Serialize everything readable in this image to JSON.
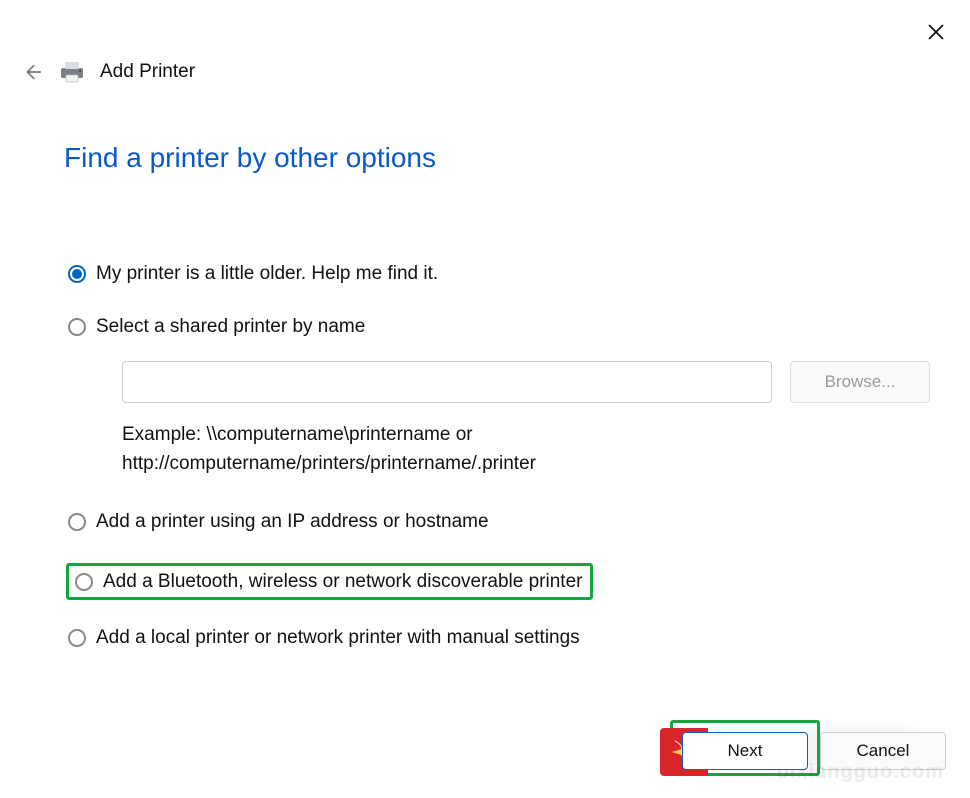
{
  "window": {
    "title": "Add Printer"
  },
  "page": {
    "heading": "Find a printer by other options"
  },
  "options": {
    "older": {
      "label": "My printer is a little older. Help me find it.",
      "selected": true
    },
    "shared": {
      "label": "Select a shared printer by name",
      "selected": false,
      "input_value": "",
      "browse_label": "Browse...",
      "example_line1": "Example: \\\\computername\\printername or",
      "example_line2": "http://computername/printers/printername/.printer"
    },
    "ip": {
      "label": "Add a printer using an IP address or hostname",
      "selected": false
    },
    "bluetooth": {
      "label": "Add a Bluetooth, wireless or network discoverable printer",
      "selected": false,
      "highlighted": true
    },
    "local": {
      "label": "Add a local printer or network printer with manual settings",
      "selected": false
    }
  },
  "footer": {
    "next_label": "Next",
    "cancel_label": "Cancel"
  },
  "icons": {
    "close": "close-icon",
    "back": "back-arrow-icon",
    "printer": "printer-icon",
    "sparkle": "sparkle-icon"
  },
  "watermark": "bixiangguo.com",
  "colors": {
    "heading": "#0a58ca",
    "accent": "#0067c0",
    "highlight": "#11a83f",
    "badge": "#d8252a"
  }
}
